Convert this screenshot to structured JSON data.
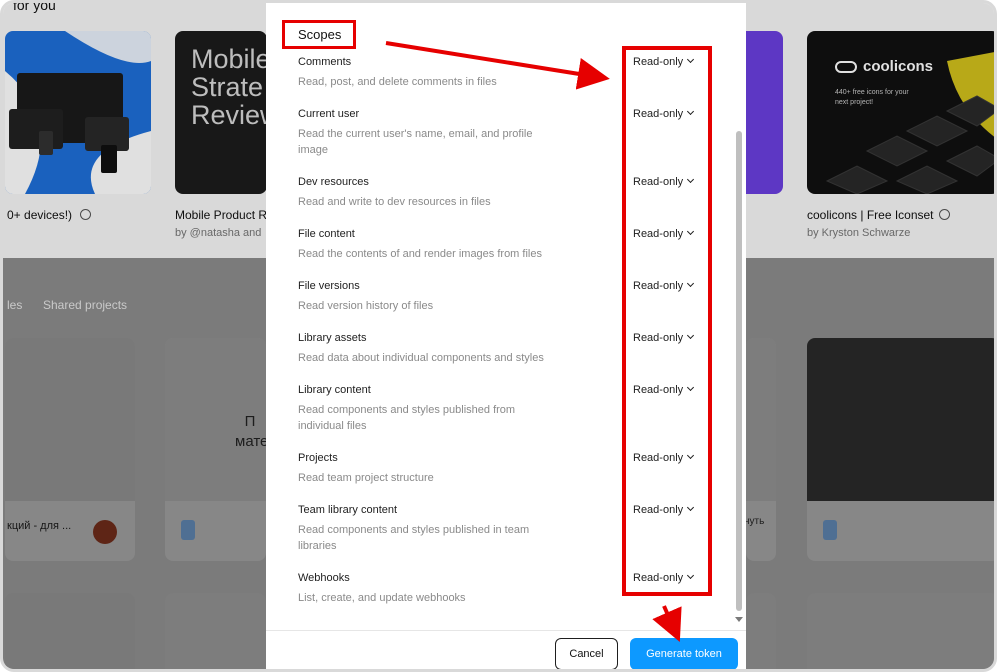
{
  "background": {
    "section_heading": "for you",
    "cards": [
      {
        "title": "0+ devices!)",
        "author": ""
      },
      {
        "title": "Mobile Product R",
        "author": "by @natasha and"
      },
      {
        "title": "coolicons | Free Iconset",
        "author": "by Kryston Schwarze"
      }
    ],
    "card2_thumb_text": "Mobile Strate Review",
    "coolicons_thumb": {
      "brand": "coolicons",
      "tagline": "440+ free icons for your next project!"
    },
    "tabs": [
      "les",
      "Shared projects"
    ],
    "project_texts": {
      "left_card_title": "кций - для ...",
      "center_text": "П мате",
      "right_text": "нуть"
    }
  },
  "modal": {
    "section_title": "Scopes",
    "scopes": [
      {
        "name": "Comments",
        "description": "Read, post, and delete comments in files",
        "value": "Read-only"
      },
      {
        "name": "Current user",
        "description": "Read the current user's name, email, and profile image",
        "value": "Read-only"
      },
      {
        "name": "Dev resources",
        "description": "Read and write to dev resources in files",
        "value": "Read-only"
      },
      {
        "name": "File content",
        "description": "Read the contents of and render images from files",
        "value": "Read-only"
      },
      {
        "name": "File versions",
        "description": "Read version history of files",
        "value": "Read-only"
      },
      {
        "name": "Library assets",
        "description": "Read data about individual components and styles",
        "value": "Read-only"
      },
      {
        "name": "Library content",
        "description": "Read components and styles published from individual files",
        "value": "Read-only"
      },
      {
        "name": "Projects",
        "description": "Read team project structure",
        "value": "Read-only"
      },
      {
        "name": "Team library content",
        "description": "Read components and styles published in team libraries",
        "value": "Read-only"
      },
      {
        "name": "Webhooks",
        "description": "List, create, and update webhooks",
        "value": "Read-only"
      }
    ],
    "cancel_label": "Cancel",
    "generate_label": "Generate token"
  },
  "colors": {
    "annotation_red": "#e60000",
    "primary_button": "#0d99ff",
    "coolicons_yellow": "#f5e01e"
  }
}
